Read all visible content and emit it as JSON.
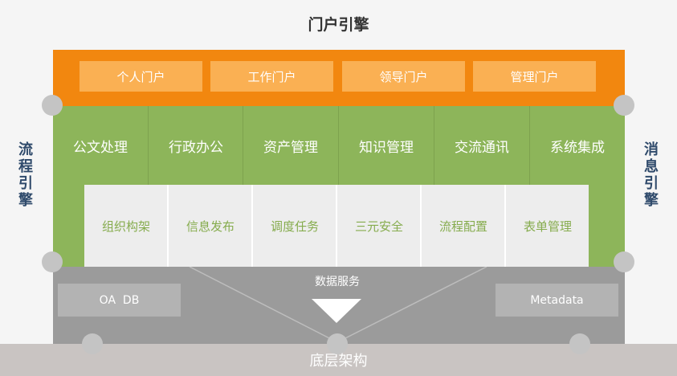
{
  "title": "门户引擎",
  "portals": [
    "个人门户",
    "工作门户",
    "领导门户",
    "管理门户"
  ],
  "apps": [
    "公文处理",
    "行政办公",
    "资产管理",
    "知识管理",
    "交流通讯",
    "系统集成"
  ],
  "services": [
    "组织构架",
    "信息发布",
    "调度任务",
    "三元安全",
    "流程配置",
    "表单管理"
  ],
  "data_layer": {
    "label": "数据服务",
    "left_db": "OA  DB",
    "right_db": "Metadata"
  },
  "base": "底层架构",
  "left_engine": "流程引擎",
  "right_engine": "消息引擎",
  "colors": {
    "portal": "#f2870f",
    "portal_button": "#fab053",
    "application": "#8db55a",
    "service_text": "#86ac4e",
    "data": "#9b9b9b",
    "base": "#c9c4c2",
    "engine_text": "#2f4a6b"
  }
}
